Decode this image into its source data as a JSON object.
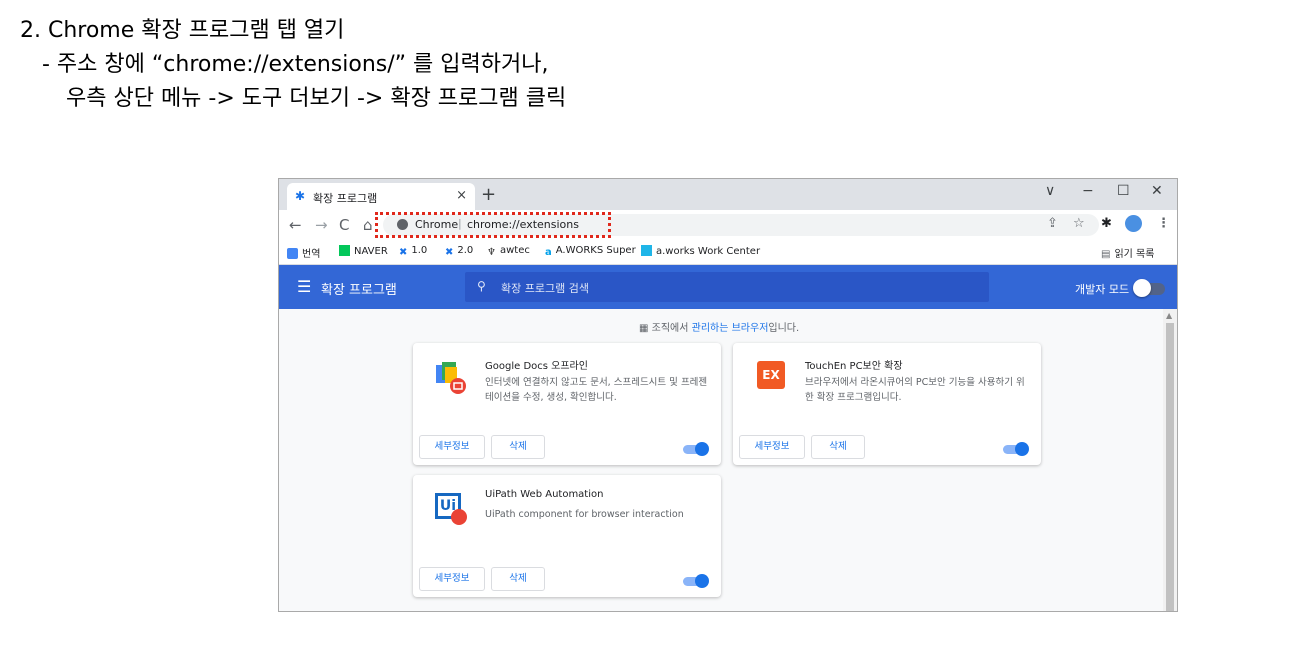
{
  "slide": {
    "line1": "2. Chrome 확장 프로그램 탭 열기",
    "line2": "- 주소 창에 “chrome://extensions/” 를 입력하거나,",
    "line3": "우측 상단 메뉴 -> 도구 더보기 -> 확장 프로그램 클릭"
  },
  "browser": {
    "tab_title": "확장 프로그램",
    "tab_close": "×",
    "new_tab": "+",
    "window_controls": [
      "∨",
      "−",
      "☐",
      "✕"
    ],
    "nav": {
      "back": "←",
      "forward": "→",
      "reload": "C",
      "home": "⌂"
    },
    "omnibox": {
      "site": "Chrome",
      "separator": "|",
      "url": "chrome://extensions"
    },
    "toolbar_icons": [
      "share-icon",
      "star-icon",
      "extensions-puzzle-icon",
      "profile-avatar",
      "menu-dots-icon"
    ],
    "bookmarks": [
      {
        "label": "번역",
        "icon": "translate-icon",
        "color": "#4285f4"
      },
      {
        "label": "NAVER",
        "icon": "naver-n-icon",
        "color": "#03c75a"
      },
      {
        "label": "1.0",
        "icon": "uipath-icon",
        "color": "#1a73e8"
      },
      {
        "label": "2.0",
        "icon": "uipath-icon",
        "color": "#1a73e8"
      },
      {
        "label": "awtec",
        "icon": "awtec-icon",
        "color": "#333333"
      },
      {
        "label": "A.WORKS Super",
        "icon": "aworks-icon",
        "color": "#00a0e9"
      },
      {
        "label": "a.works Work Center",
        "icon": "aworks-box-icon",
        "color": "#1fb5e8"
      }
    ],
    "reading_list": "읽기 목록"
  },
  "extensions_page": {
    "header_title": "확장 프로그램",
    "search_placeholder": "확장 프로그램 검색",
    "dev_mode_label": "개발자 모드",
    "managed_prefix": "조직에서 ",
    "managed_link": "관리하는 브라우저",
    "managed_suffix": "입니다.",
    "extensions": [
      {
        "name": "Google Docs 오프라인",
        "description": "인터넷에 연결하지 않고도 문서, 스프레드시트 및 프레젠테이션을 수정, 생성, 확인합니다.",
        "details_label": "세부정보",
        "remove_label": "삭제",
        "enabled": true,
        "icon": "google-docs-offline-icon"
      },
      {
        "name": "TouchEn PC보안 확장",
        "description": "브라우저에서 라온시큐어의 PC보안 기능을 사용하기 위한 확장 프로그램입니다.",
        "details_label": "세부정보",
        "remove_label": "삭제",
        "enabled": true,
        "icon": "touchen-ex-icon",
        "icon_text": "EX"
      },
      {
        "name": "UiPath Web Automation",
        "description": "UiPath component for browser interaction",
        "details_label": "세부정보",
        "remove_label": "삭제",
        "enabled": true,
        "icon": "uipath-ui-icon",
        "icon_text": "Ui"
      }
    ]
  },
  "colors": {
    "header_blue": "#3367d6",
    "accent": "#1a73e8",
    "highlight_red": "#e0281b"
  }
}
